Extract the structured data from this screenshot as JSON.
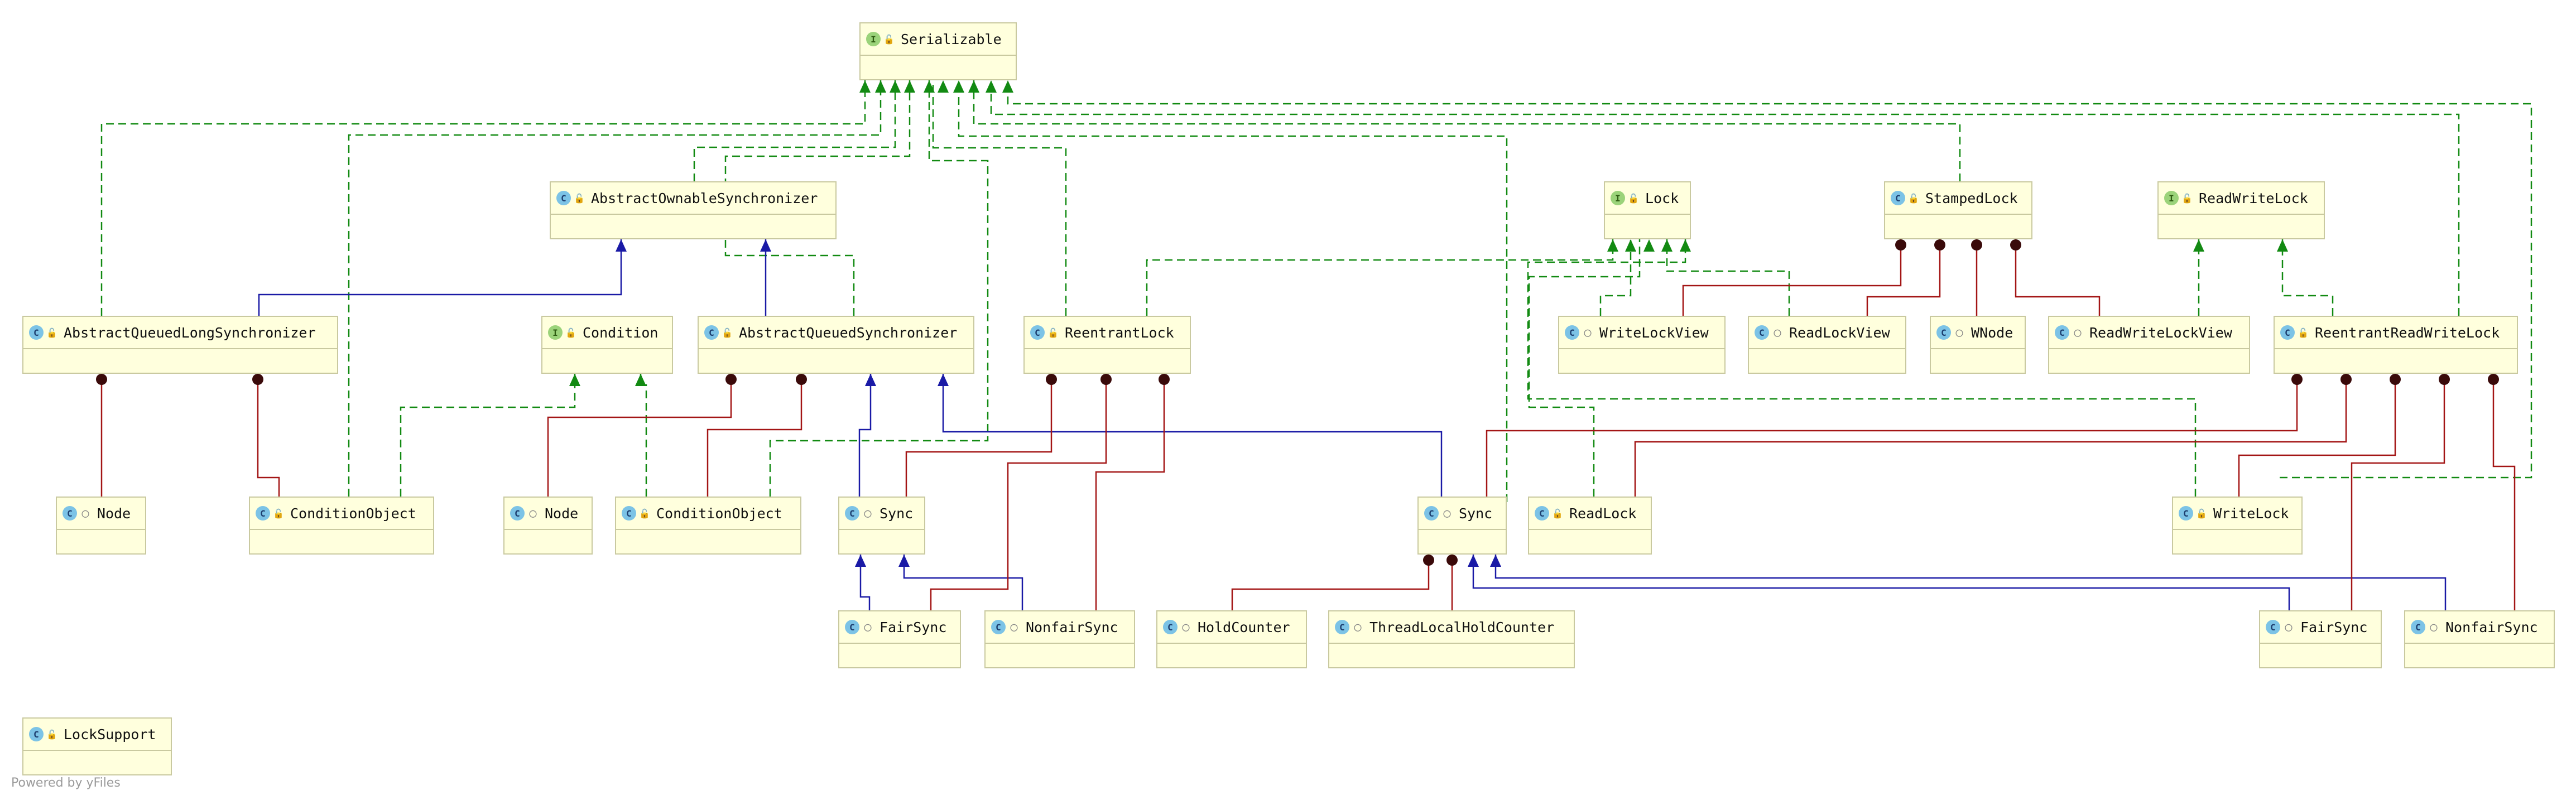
{
  "nodes": {
    "serializable": {
      "name": "Serializable",
      "kind": "interface",
      "vis": "public"
    },
    "aos": {
      "name": "AbstractOwnableSynchronizer",
      "kind": "class",
      "vis": "public"
    },
    "lock": {
      "name": "Lock",
      "kind": "interface",
      "vis": "public"
    },
    "stampedlock": {
      "name": "StampedLock",
      "kind": "class",
      "vis": "public"
    },
    "readwritelock": {
      "name": "ReadWriteLock",
      "kind": "interface",
      "vis": "public"
    },
    "aqls": {
      "name": "AbstractQueuedLongSynchronizer",
      "kind": "class",
      "vis": "public"
    },
    "condition": {
      "name": "Condition",
      "kind": "interface",
      "vis": "public"
    },
    "aqs": {
      "name": "AbstractQueuedSynchronizer",
      "kind": "class",
      "vis": "public"
    },
    "reentrantlock": {
      "name": "ReentrantLock",
      "kind": "class",
      "vis": "public"
    },
    "writelockview": {
      "name": "WriteLockView",
      "kind": "class",
      "vis": "package"
    },
    "readlockview": {
      "name": "ReadLockView",
      "kind": "class",
      "vis": "package"
    },
    "wnode": {
      "name": "WNode",
      "kind": "class",
      "vis": "package"
    },
    "readwritelockview": {
      "name": "ReadWriteLockView",
      "kind": "class",
      "vis": "package"
    },
    "rrwl": {
      "name": "ReentrantReadWriteLock",
      "kind": "class",
      "vis": "public"
    },
    "node1": {
      "name": "Node",
      "kind": "class",
      "vis": "package"
    },
    "condobj1": {
      "name": "ConditionObject",
      "kind": "class",
      "vis": "public"
    },
    "node2": {
      "name": "Node",
      "kind": "class",
      "vis": "package"
    },
    "condobj2": {
      "name": "ConditionObject",
      "kind": "class",
      "vis": "public"
    },
    "sync1": {
      "name": "Sync",
      "kind": "class",
      "vis": "package"
    },
    "sync2": {
      "name": "Sync",
      "kind": "class",
      "vis": "package"
    },
    "readlock": {
      "name": "ReadLock",
      "kind": "class",
      "vis": "public"
    },
    "writelock": {
      "name": "WriteLock",
      "kind": "class",
      "vis": "public"
    },
    "fairsync1": {
      "name": "FairSync",
      "kind": "class",
      "vis": "package"
    },
    "nonfairsync1": {
      "name": "NonfairSync",
      "kind": "class",
      "vis": "package"
    },
    "holdcounter": {
      "name": "HoldCounter",
      "kind": "class",
      "vis": "package"
    },
    "tlhc": {
      "name": "ThreadLocalHoldCounter",
      "kind": "class",
      "vis": "package"
    },
    "fairsync2": {
      "name": "FairSync",
      "kind": "class",
      "vis": "package"
    },
    "nonfairsync2": {
      "name": "NonfairSync",
      "kind": "class",
      "vis": "package"
    },
    "locksupport": {
      "name": "LockSupport",
      "kind": "class",
      "vis": "public"
    }
  },
  "edge_colors": {
    "extends": "#1a1aa6",
    "implements": "#128a12",
    "inner": "#a31515"
  },
  "footer": "Powered by yFiles"
}
